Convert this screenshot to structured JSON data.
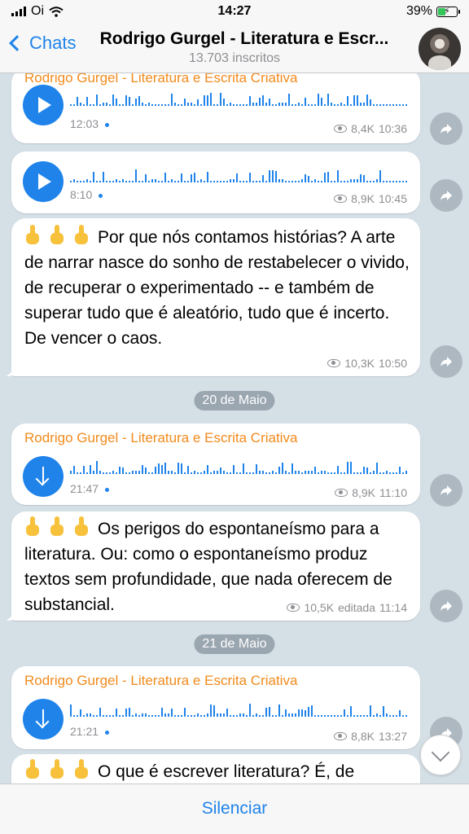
{
  "status": {
    "carrier": "Oi",
    "time": "14:27",
    "battery": "39%"
  },
  "header": {
    "back_label": "Chats",
    "title": "Rodrigo Gurgel - Literatura e Escr...",
    "subtitle": "13.703 inscritos"
  },
  "messages": {
    "m1": {
      "sender": "Rodrigo Gurgel - Literatura e Escrita Criativa",
      "duration": "12:03",
      "views": "8,4K",
      "time": "10:36"
    },
    "m2": {
      "duration": "8:10",
      "views": "8,9K",
      "time": "10:45"
    },
    "m3": {
      "text": "Por que nós contamos histórias? A arte de narrar nasce do sonho de restabelecer o vivido, de recuperar o experimentado -- e também de superar tudo que é aleatório, tudo que é incerto. De vencer o caos.",
      "views": "10,3K",
      "time": "10:50"
    },
    "date1": "20 de Maio",
    "m4": {
      "sender": "Rodrigo Gurgel - Literatura e Escrita Criativa",
      "duration": "21:47",
      "views": "8,9K",
      "time": "11:10"
    },
    "m5": {
      "text": "Os perigos do espontaneísmo para a literatura. Ou: como o espontaneísmo produz textos sem profundidade, que nada oferecem de substancial.",
      "views": "10,5K",
      "edited": "editada",
      "time": "11:14"
    },
    "date2": "21 de Maio",
    "m6": {
      "sender": "Rodrigo Gurgel - Literatura e Escrita Criativa",
      "duration": "21:21",
      "views": "8,8K",
      "time": "13:27"
    },
    "m7": {
      "text": "O que é escrever literatura? É, de"
    }
  },
  "footer": {
    "mute_label": "Silenciar"
  },
  "colors": {
    "accent": "#1f83ea",
    "sender": "#f28a1c",
    "meta": "#8e8e93"
  }
}
